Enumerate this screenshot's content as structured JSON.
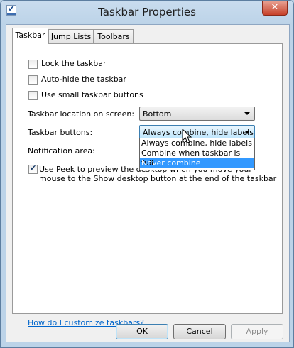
{
  "window": {
    "title": "Taskbar Properties",
    "close_glyph": "✕"
  },
  "tabs": [
    {
      "label": "Taskbar",
      "active": true
    },
    {
      "label": "Jump Lists",
      "active": false
    },
    {
      "label": "Toolbars",
      "active": false
    }
  ],
  "options": {
    "lock": {
      "label": "Lock the taskbar",
      "checked": false
    },
    "autohide": {
      "label": "Auto-hide the taskbar",
      "checked": false
    },
    "small": {
      "label": "Use small taskbar buttons",
      "checked": false
    },
    "peek": {
      "label": "Use Peek to preview the desktop when you move your mouse to the Show desktop button at the end of the taskbar",
      "checked": true
    }
  },
  "location": {
    "label": "Taskbar location on screen:",
    "value": "Bottom"
  },
  "buttons": {
    "label": "Taskbar buttons:",
    "value": "Always combine, hide labels",
    "options": [
      "Always combine, hide labels",
      "Combine when taskbar is full",
      "Never combine"
    ],
    "highlighted_index": 2
  },
  "notification": {
    "label": "Notification area:"
  },
  "help_link": "How do I customize taskbars?",
  "footer": {
    "ok": "OK",
    "cancel": "Cancel",
    "apply": "Apply"
  },
  "colors": {
    "selection": "#3399ff",
    "link": "#0066cc",
    "close": "#c7422b"
  }
}
